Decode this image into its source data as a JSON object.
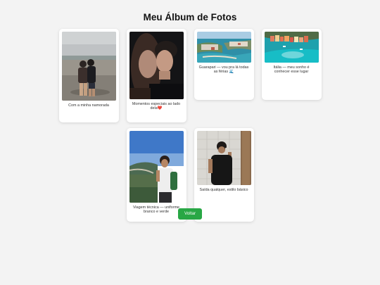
{
  "page": {
    "title": "Meu Álbum de Fotos"
  },
  "photos": [
    {
      "caption": "Com a minha namorada",
      "image": "couple-on-beach-photo"
    },
    {
      "caption": "Momentos especiais ao lado dela❤️",
      "image": "couple-kiss-photo"
    },
    {
      "caption": "Guarapari — vou pra lá todas as férias 🌊",
      "image": "guarapari-coast-photo"
    },
    {
      "caption": "Itália — meu sonho é conhecer esse lugar",
      "image": "italy-coastal-village-photo"
    },
    {
      "caption": "Viagem técnica — uniforme branco e verde",
      "image": "man-on-lookout-photo"
    },
    {
      "caption": "Saída qualquer, estilo básico",
      "image": "mirror-selfie-photo"
    }
  ],
  "actions": {
    "back_label": "Voltar"
  },
  "colors": {
    "background": "#f3f3f3",
    "card": "#ffffff",
    "button": "#28a745"
  }
}
